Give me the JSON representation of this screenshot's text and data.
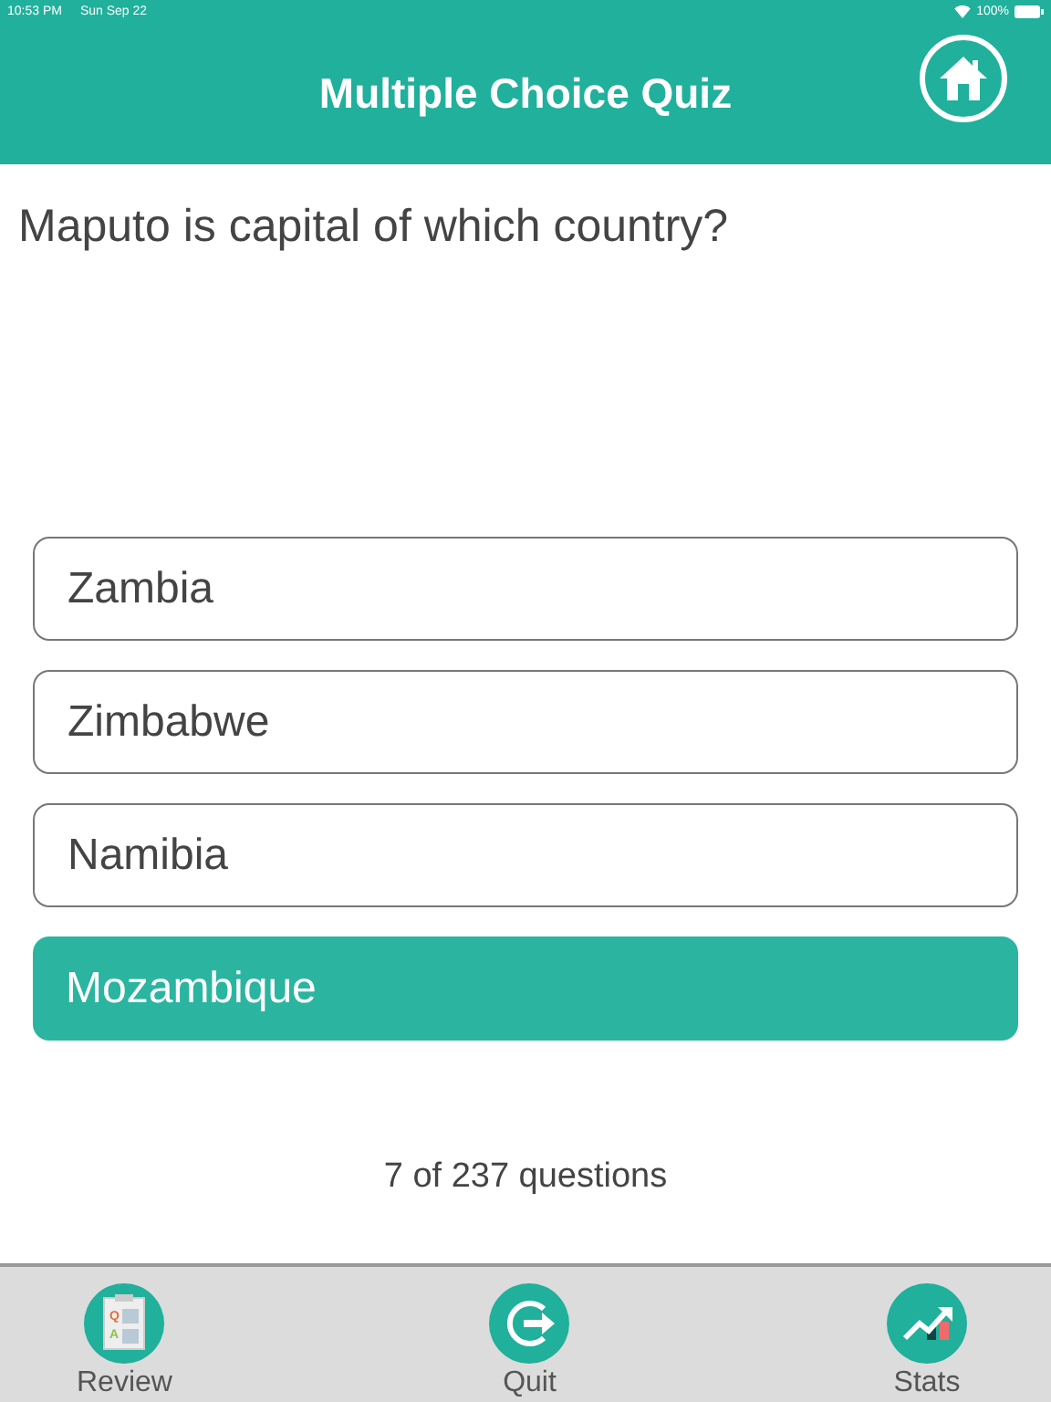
{
  "status_bar": {
    "time": "10:53 PM",
    "date": "Sun Sep 22",
    "battery": "100%"
  },
  "header": {
    "title": "Multiple Choice Quiz"
  },
  "question": "Maputo is capital of which country?",
  "options": [
    {
      "label": "Zambia",
      "selected": false
    },
    {
      "label": "Zimbabwe",
      "selected": false
    },
    {
      "label": "Namibia",
      "selected": false
    },
    {
      "label": "Mozambique",
      "selected": true
    }
  ],
  "progress": "7 of 237 questions",
  "tabs": [
    {
      "kind": "review",
      "label": "Review",
      "letters": [
        "Q",
        "A"
      ]
    },
    {
      "kind": "quit",
      "label": "Quit"
    },
    {
      "kind": "stats",
      "label": "Stats"
    }
  ]
}
